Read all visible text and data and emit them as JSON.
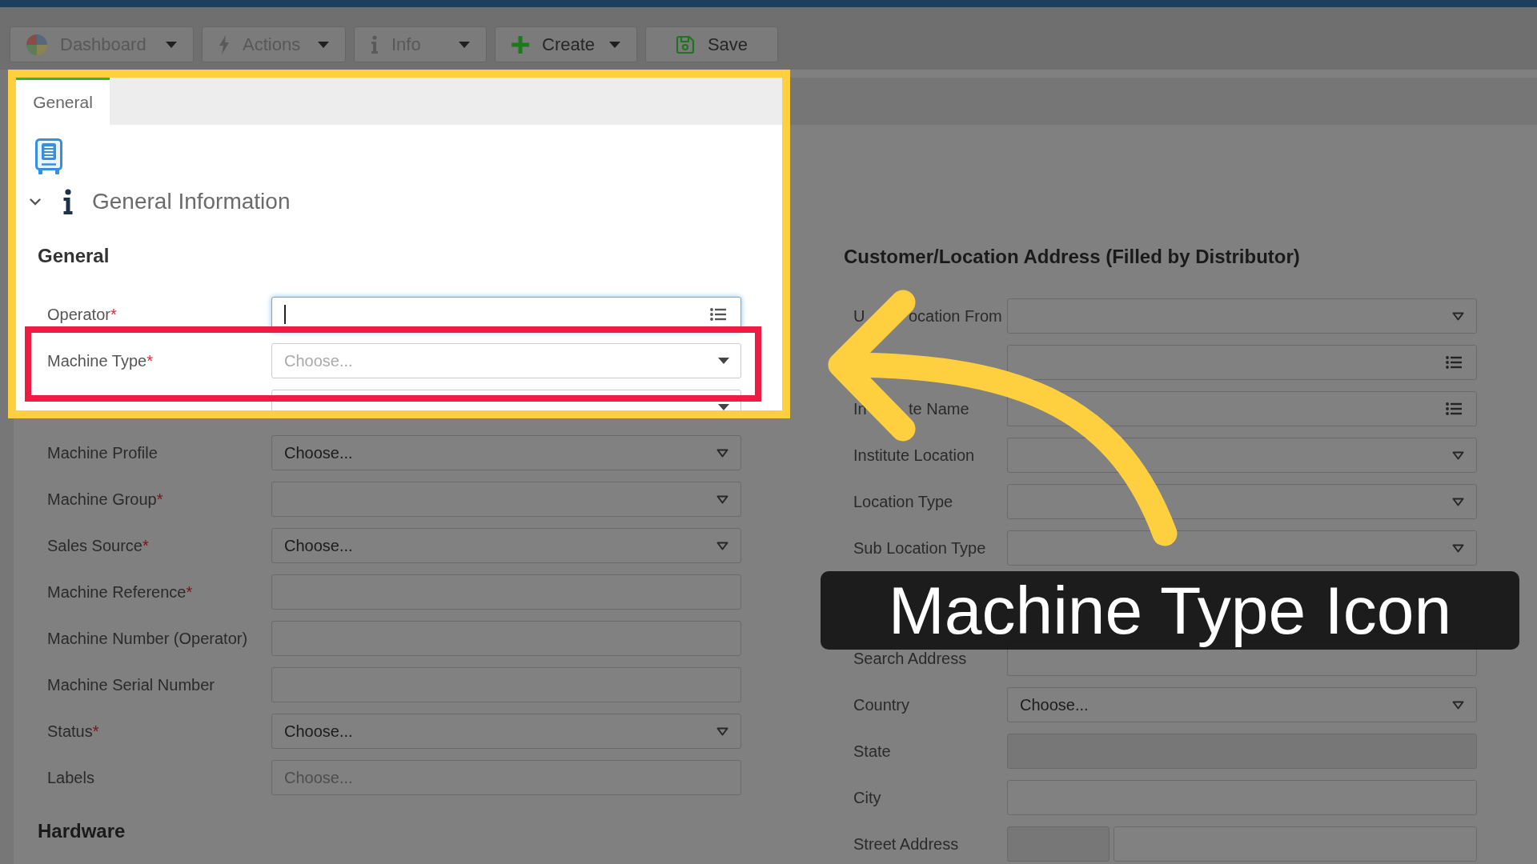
{
  "toolbar": [
    {
      "label": "Dashboard",
      "disabled": true,
      "dropdown": true
    },
    {
      "label": "Actions",
      "disabled": true,
      "dropdown": true
    },
    {
      "label": "Info",
      "disabled": true,
      "dropdown": true
    },
    {
      "label": "Create",
      "disabled": false,
      "dropdown": true
    },
    {
      "label": "Save",
      "disabled": false,
      "dropdown": false
    }
  ],
  "tabs": [
    {
      "label": "General",
      "selected": true
    }
  ],
  "section": {
    "title": "General Information",
    "expanded": true
  },
  "left_column": [
    {
      "heading": "General",
      "fields": [
        {
          "label": "Operator",
          "required_mark": "*",
          "kind": "lookup",
          "focused": true
        },
        {
          "label": "Machine Type",
          "required_mark": "*",
          "kind": "combobox",
          "placeholder": "Choose...",
          "focused": false
        },
        {
          "kind": "combobox",
          "focused": false
        },
        {
          "label": "Machine Profile",
          "kind": "select",
          "value": "Choose...",
          "focused": false
        },
        {
          "label": "Machine Group",
          "required_mark": "*",
          "kind": "select",
          "focused": false
        },
        {
          "label": "Sales Source",
          "required_mark": "*",
          "kind": "select",
          "value": "Choose...",
          "focused": false
        },
        {
          "label": "Machine Reference",
          "required_mark": "*",
          "kind": "text",
          "focused": false
        },
        {
          "label": "Machine Number (Operator)",
          "kind": "text",
          "focused": false
        },
        {
          "label": "Machine Serial Number",
          "kind": "text",
          "focused": false
        },
        {
          "label": "Status",
          "required_mark": "*",
          "kind": "select",
          "value": "Choose...",
          "focused": false
        },
        {
          "label": "Labels",
          "kind": "multiselect",
          "placeholder": "Choose...",
          "focused": false
        }
      ]
    },
    {
      "heading": "Hardware"
    }
  ],
  "right_column": [
    {
      "heading": "Customer/Location Address (Filled by Distributor)",
      "fields": [
        {
          "label_parts": [
            "U",
            "ocation From"
          ],
          "kind": "select"
        },
        {
          "kind": "lookup"
        },
        {
          "label_parts": [
            "In",
            "te Name"
          ],
          "kind": "lookup"
        },
        {
          "label": "Institute Location",
          "kind": "select"
        },
        {
          "label": "Location Type",
          "kind": "select"
        },
        {
          "label": "Sub Location Type",
          "kind": "select"
        }
      ]
    },
    {
      "fields": [
        {
          "label": "Search Address",
          "kind": "text"
        },
        {
          "label": "Country",
          "kind": "select",
          "value": "Choose..."
        },
        {
          "label": "State",
          "kind": "readonly"
        },
        {
          "label": "City",
          "kind": "text"
        },
        {
          "label": "Street Address",
          "kind": "split"
        }
      ]
    }
  ],
  "annotation": {
    "caption": "Machine Type Icon"
  }
}
